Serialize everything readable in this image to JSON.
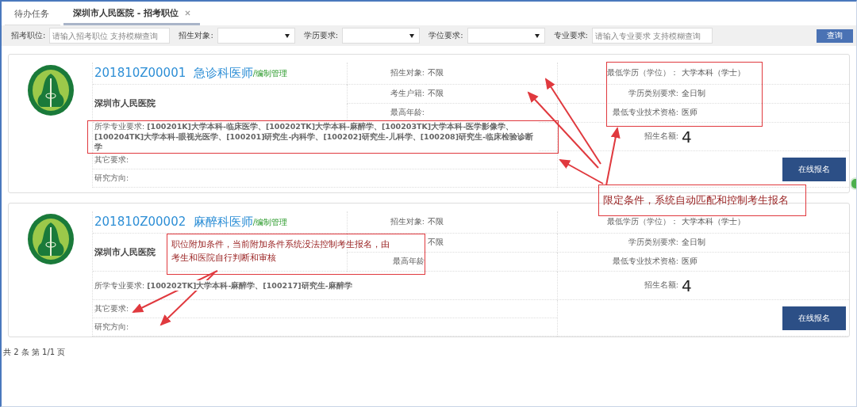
{
  "tabs": [
    {
      "label": "待办任务",
      "selected": false,
      "closable": false
    },
    {
      "label": "深圳市人民医院 - 招考职位",
      "selected": true,
      "closable": true
    }
  ],
  "filters": [
    {
      "kind": "input",
      "label": "招考职位:",
      "placeholder": "请输入招考职位 支持模糊查询"
    },
    {
      "kind": "select",
      "label": "招生对象:"
    },
    {
      "kind": "select",
      "label": "学历要求:"
    },
    {
      "kind": "select",
      "label": "学位要求:"
    },
    {
      "kind": "input",
      "label": "专业要求:",
      "placeholder": "请输入专业要求 支持模糊查询"
    }
  ],
  "search_button": "查询",
  "positions": [
    {
      "code": "201810Z00001",
      "title": "急诊科医师",
      "tag": "/编制管理",
      "hospital": "深圳市人民医院",
      "left_fields": [
        {
          "label": "招生对象:",
          "value": "不限"
        },
        {
          "label": "考生户籍:",
          "value": "不限"
        },
        {
          "label": "最高年龄:"
        }
      ],
      "right_fields": [
        {
          "label": "最低学历（学位）：",
          "value": "大学本科（学士）"
        },
        {
          "label": "学历类别要求:",
          "value": "全日制"
        },
        {
          "label": "最低专业技术资格:",
          "value": "医师"
        }
      ],
      "major_label": "所学专业要求:",
      "major": "[100201K]大学本科-临床医学、[100202TK]大学本科-麻醉学、[100203TK]大学本科-医学影像学、[100204TK]大学本科-眼视光医学、[100201]研究生-内科学、[100202]研究生-儿科学、[100208]研究生-临床检验诊断学",
      "quota_label": "招生名额:",
      "quota": "4",
      "other_label": "其它要求:",
      "research_label": "研究方向:",
      "apply_button": "在线报名"
    },
    {
      "code": "201810Z00002",
      "title": "麻醉科医师",
      "tag": "/编制管理",
      "hospital": "深圳市人民医院",
      "left_fields": [
        {
          "label": "招生对象:",
          "value": "不限"
        },
        {
          "value": "不限"
        },
        {
          "label": "最高年龄"
        }
      ],
      "right_fields": [
        {
          "label": "最低学历（学位）：",
          "value": "大学本科（学士）"
        },
        {
          "label": "学历类别要求:",
          "value": "全日制"
        },
        {
          "label": "最低专业技术资格:",
          "value": "医师"
        }
      ],
      "major_label": "所学专业要求:",
      "major": "[100202TK]大学本科-麻醉学、[100217]研究生-麻醉学",
      "quota_label": "招生名额:",
      "quota": "4",
      "other_label": "其它要求:",
      "research_label": "研究方向:",
      "apply_button": "在线报名"
    }
  ],
  "pager": "共 2 条 第 1/1 页",
  "annotations": [
    {
      "kind": "callout",
      "text": "限定条件，系统自动匹配和控制考生报名"
    },
    {
      "kind": "callout",
      "text": "职位附加条件，当前附加条件系统没法控制考生报名，由考生和医院自行判断和审核"
    }
  ]
}
